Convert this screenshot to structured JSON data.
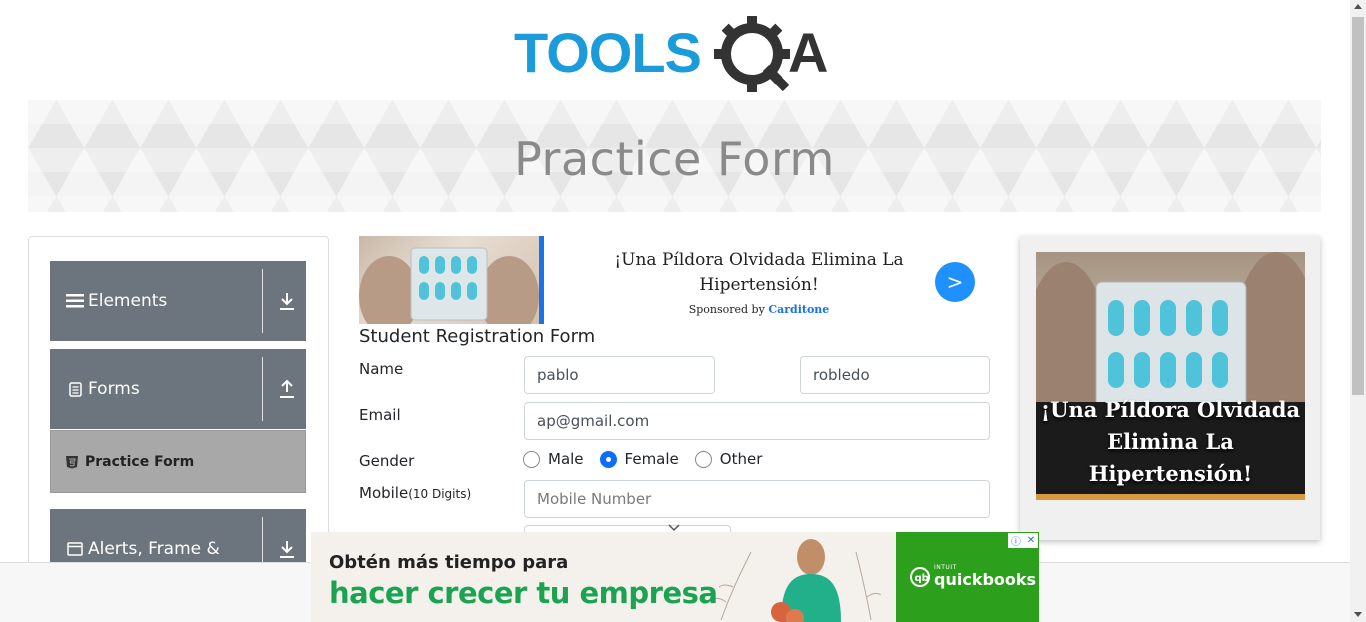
{
  "page": {
    "title": "Practice Form"
  },
  "logo": {
    "text_left": "TOOLS",
    "text_right": "QA",
    "primary_color": "#1b9bd9",
    "secondary_color": "#333333"
  },
  "sidebar": {
    "groups": [
      {
        "label": "Elements",
        "icon": "hamburger-icon",
        "arrow": "download-arrow-icon"
      },
      {
        "label": "Forms",
        "icon": "document-icon",
        "arrow": "upload-arrow-icon"
      },
      {
        "label": "Alerts, Frame &",
        "icon": "window-icon",
        "arrow": "download-arrow-icon"
      }
    ],
    "active_item": {
      "label": "Practice Form",
      "icon": "html5-icon"
    }
  },
  "ad_top": {
    "headline": "¡Una Píldora Olvidada Elimina La Hipertensión!",
    "sponsored_prefix": "Sponsored by",
    "sponsor": "Carditone",
    "go_label": ">"
  },
  "form": {
    "title": "Student Registration Form",
    "name_label": "Name",
    "first_name": "pablo",
    "last_name": "robledo",
    "email_label": "Email",
    "email": "ap@gmail.com",
    "gender_label": "Gender",
    "gender_options": [
      "Male",
      "Female",
      "Other"
    ],
    "gender_selected": "Female",
    "mobile_label": "Mobile",
    "mobile_hint": "(10 Digits)",
    "mobile_placeholder": "Mobile Number"
  },
  "ad_right": {
    "headline": "¡Una Píldora Olvidada Elimina La Hipertensión!"
  },
  "ad_bottom": {
    "line1": "Obtén más tiempo para",
    "line2": "hacer crecer tu empresa",
    "brand": "quickbooks",
    "brand_prefix": "INTUIT",
    "brand_color": "#2ca01c"
  }
}
